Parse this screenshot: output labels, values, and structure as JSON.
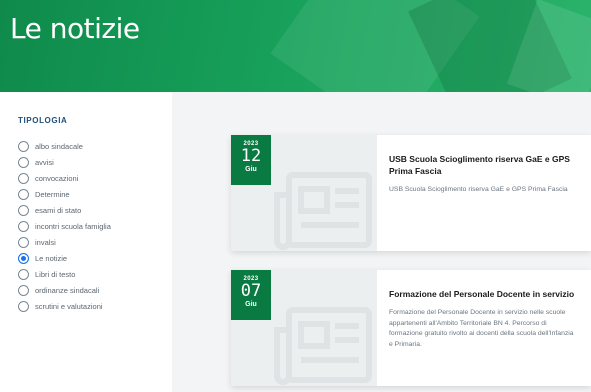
{
  "hero": {
    "title": "Le notizie"
  },
  "sidebar": {
    "title": "TIPOLOGIA",
    "filters": [
      {
        "label": "albo sindacale",
        "checked": false
      },
      {
        "label": "avvisi",
        "checked": false
      },
      {
        "label": "convocazioni",
        "checked": false
      },
      {
        "label": "Determine",
        "checked": false
      },
      {
        "label": "esami di stato",
        "checked": false
      },
      {
        "label": "incontri scuola famiglia",
        "checked": false
      },
      {
        "label": "invalsi",
        "checked": false
      },
      {
        "label": "Le notizie",
        "checked": true
      },
      {
        "label": "Libri di testo",
        "checked": false
      },
      {
        "label": "ordinanze sindacali",
        "checked": false
      },
      {
        "label": "scrutini e valutazioni",
        "checked": false
      }
    ]
  },
  "news": [
    {
      "year": "2023",
      "day": "12",
      "month": "Giu",
      "title": "USB Scuola Scioglimento riserva GaE e GPS Prima Fascia",
      "description": "USB Scuola Scioglimento riserva GaE e GPS Prima Fascia"
    },
    {
      "year": "2023",
      "day": "07",
      "month": "Giu",
      "title": "Formazione del Personale Docente in servizio",
      "description": "Formazione del Personale Docente in servizio nelle scuole appartenenti all'Ambito Territoriale BN 4. Percorso di formazione gratuito rivolto ai docenti della scuola dell'Infanzia e Primaria."
    }
  ],
  "colors": {
    "brand_green": "#0a7a43",
    "radio_checked": "#1a73e8",
    "sidebar_title": "#1f4f7a"
  }
}
